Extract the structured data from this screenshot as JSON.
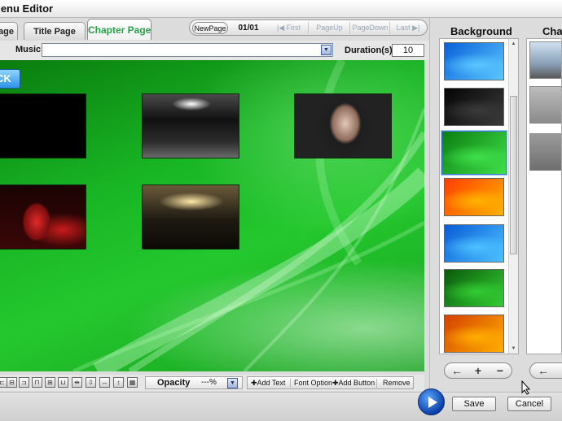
{
  "window": {
    "title": "Menu Editor"
  },
  "tabs": [
    {
      "label": "Page"
    },
    {
      "label": "Title Page"
    },
    {
      "label": "Chapter Page",
      "active": true
    }
  ],
  "page_nav": {
    "new_page": "NewPage",
    "counter": "01/01",
    "first": "First",
    "page_up": "PageUp",
    "page_down": "PageDown",
    "last": "Last"
  },
  "music": {
    "label": "Music",
    "value": ""
  },
  "duration": {
    "label": "Duration(s)",
    "value": "10"
  },
  "canvas": {
    "back_button": "CK",
    "chapter_count": 5
  },
  "bottom_toolbar": {
    "opacity_label": "Opacity",
    "opacity_value": "---%",
    "add_text": "Add Text",
    "font_option": "Font Option",
    "add_button": "Add Button",
    "remove": "Remove"
  },
  "background_panel": {
    "title": "Background",
    "selected_index": 2,
    "thumbnails": [
      {
        "name": "blue-light",
        "colors": [
          "#0a5fd8",
          "#59c7ff"
        ]
      },
      {
        "name": "dark-smoke",
        "colors": [
          "#050505",
          "#3a3a3a"
        ]
      },
      {
        "name": "green-wave",
        "colors": [
          "#0c7d10",
          "#3fe04a"
        ]
      },
      {
        "name": "orange-wave",
        "colors": [
          "#ff3d00",
          "#ffb300"
        ]
      },
      {
        "name": "blue-wave",
        "colors": [
          "#0a5bd6",
          "#4bc1ff"
        ]
      },
      {
        "name": "green-lines",
        "colors": [
          "#0a5a0a",
          "#33cc33"
        ]
      },
      {
        "name": "orange-lines",
        "colors": [
          "#d44000",
          "#ffae00"
        ]
      }
    ],
    "buttons": {
      "prev": "←",
      "add": "+",
      "remove": "−"
    }
  },
  "chapter_panel": {
    "title": "Cha",
    "prev": "←"
  },
  "footer": {
    "save": "Save",
    "cancel": "Cancel"
  },
  "colors": {
    "active_tab_text": "#2aa14a",
    "canvas_green": "#1fbf29",
    "selection_blue": "#3c7dd8"
  }
}
